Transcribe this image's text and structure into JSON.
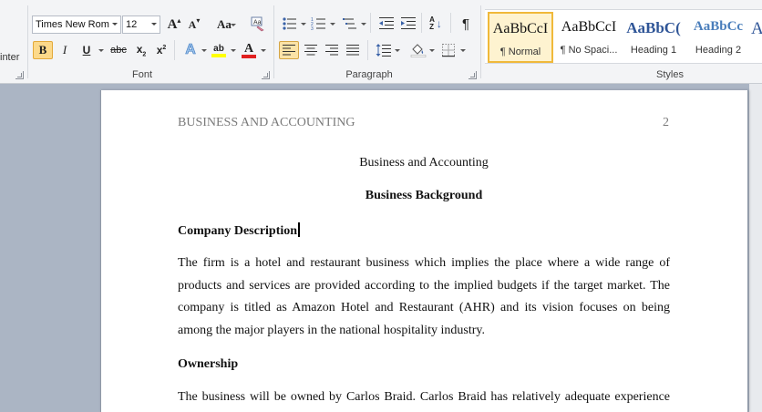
{
  "ribbon": {
    "clipboard": {
      "format_painter_partial": "inter"
    },
    "font": {
      "label": "Font",
      "font_name": "Times New Rom",
      "font_size": "12",
      "grow_font": "A",
      "shrink_font": "A",
      "change_case": "Aa",
      "bold": "B",
      "italic": "I",
      "underline": "U",
      "strikethrough": "abc",
      "subscript": "x",
      "superscript": "x",
      "sub_mark": "2",
      "sup_mark": "2",
      "text_effects": "A",
      "highlight": "ab",
      "font_color": "A",
      "font_color_hex": "#e02020",
      "highlight_hex": "#ffff00"
    },
    "paragraph": {
      "label": "Paragraph",
      "sort": "A",
      "sort_z": "Z",
      "show_marks": "¶"
    },
    "styles": {
      "label": "Styles",
      "items": [
        {
          "sample": "AaBbCcI",
          "name": "¶ Normal"
        },
        {
          "sample": "AaBbCcI",
          "name": "¶ No Spaci..."
        },
        {
          "sample": "AaBbC(",
          "name": "Heading 1"
        },
        {
          "sample": "AaBbCc",
          "name": "Heading 2"
        },
        {
          "sample": "A",
          "name": ""
        }
      ],
      "heading_color": "#2f5597"
    }
  },
  "document": {
    "running_head": "BUSINESS AND ACCOUNTING",
    "page_number": "2",
    "title": "Business and Accounting",
    "subtitle": "Business Background",
    "section1_heading": "Company Description",
    "section1_lines": [
      "The firm is a hotel and restaurant business which implies the place where a wide range of",
      "products and services are provided according to the implied budgets if the target market. The",
      "company is titled as Amazon Hotel and Restaurant (AHR) and its vision focuses on being",
      "among the major players in the national hospitality industry."
    ],
    "section2_heading": "Ownership",
    "section2_line": "The business will be owned by Carlos Braid. Carlos Braid has relatively adequate experience"
  }
}
